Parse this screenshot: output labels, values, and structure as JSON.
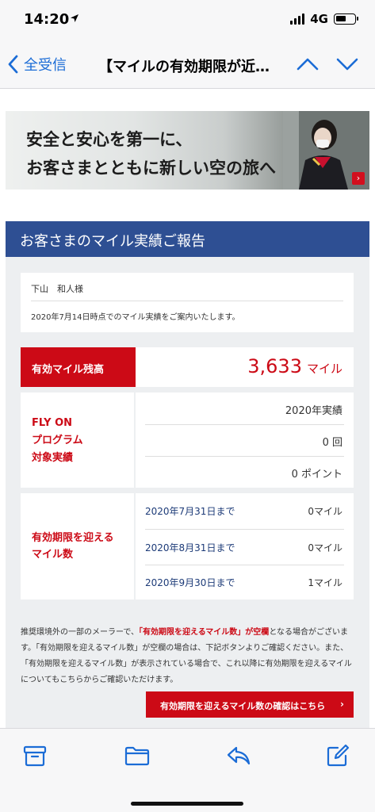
{
  "status": {
    "time": "14:20",
    "network": "4G"
  },
  "nav": {
    "back_label": "全受信",
    "title": "【マイルの有効期限が近…"
  },
  "banner": {
    "line1": "安全と安心を第一に、",
    "line2": "お客さまとともに新しい空の旅へ",
    "arrow": "›"
  },
  "report": {
    "title": "お客さまのマイル実績ご報告",
    "customer_name": "下山　和人様",
    "as_of_note": "2020年7月14日時点でのマイル実績をご案内いたします。",
    "balance": {
      "label": "有効マイル残高",
      "value": "3,633",
      "unit": "マイル"
    },
    "flyon": {
      "label_lines": [
        "FLY ON",
        "プログラム",
        "対象実績"
      ],
      "year_label": "2020年実績",
      "count": "0 回",
      "points": "0 ポイント"
    },
    "expiring": {
      "label_lines": [
        "有効期限を迎える",
        "マイル数"
      ],
      "rows": [
        {
          "date": "2020年7月31日まで",
          "miles": "0マイル"
        },
        {
          "date": "2020年8月31日まで",
          "miles": "0マイル"
        },
        {
          "date": "2020年9月30日まで",
          "miles": "1マイル"
        }
      ]
    },
    "notice": {
      "part1": "推奨環境外の一部のメーラーで、",
      "highlight": "「有効期限を迎えるマイル数」が空欄",
      "part2": "となる場合がございます。「有効期限を迎えるマイル数」が空欄の場合は、下記ボタンよりご確認ください。また、「有効期限を迎えるマイル数」が表示されている場合で、これ以降に有効期限を迎えるマイルについてもこちらからご確認いただけます。"
    },
    "confirm_button": {
      "label": "有効期限を迎えるマイル数の確認はこちら",
      "chevron": "›"
    }
  },
  "toolbar": {
    "icons": [
      "archive-icon",
      "folder-icon",
      "reply-icon",
      "compose-icon"
    ]
  },
  "colors": {
    "accent_red": "#cc0a16",
    "header_blue": "#2e4f93",
    "ios_blue": "#1b6cd6"
  }
}
